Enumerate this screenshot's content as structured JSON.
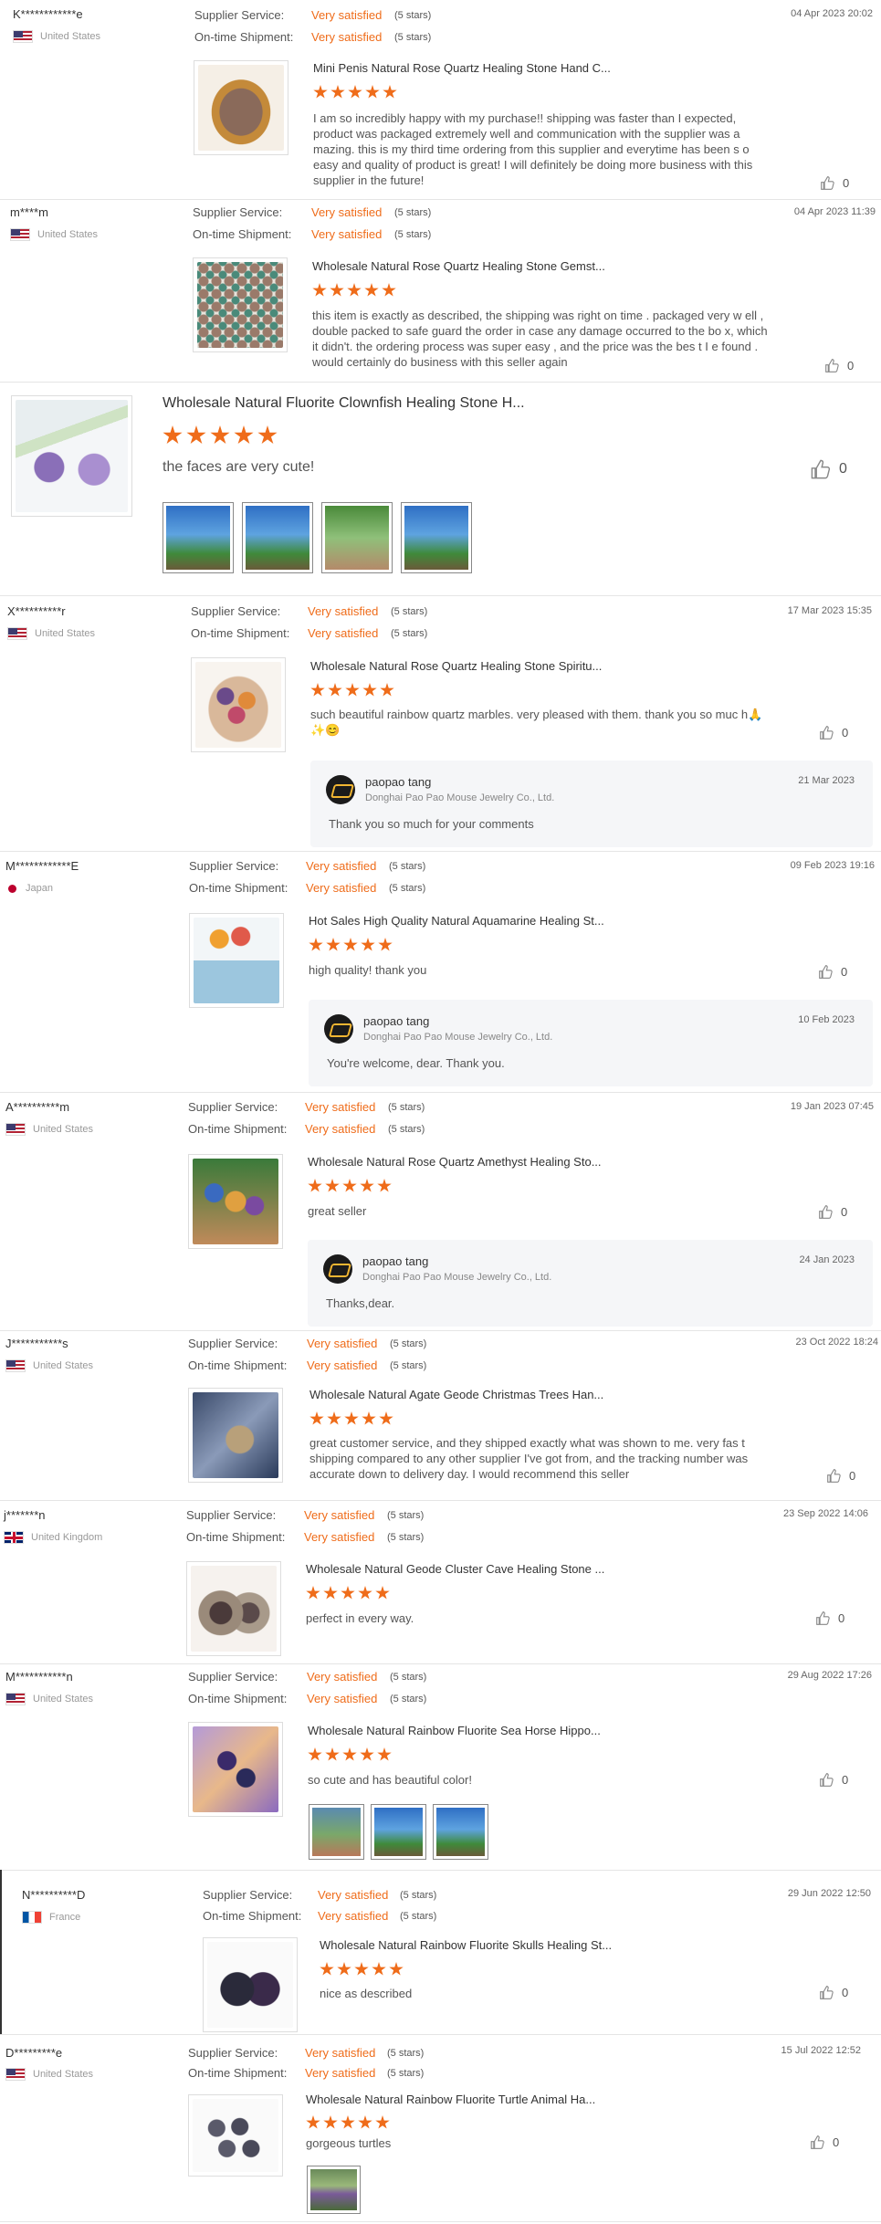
{
  "labels": {
    "supplier_service": "Supplier Service:",
    "ontime_shipment": "On-time Shipment:",
    "very_satisfied": "Very satisfied",
    "five_stars": "(5 stars)"
  },
  "colors": {
    "accent": "#ef6c1a",
    "reply_bg": "#f5f6f8"
  },
  "reviews": [
    {
      "buyer": "K************e",
      "country": "United States",
      "date": "04 Apr 2023 20:02",
      "product": "Mini Penis Natural Rose Quartz Healing Stone Hand C...",
      "text": "I am so incredibly happy with my purchase!! shipping was faster than I expected, product was packaged extremely well and communication with the supplier was a mazing. this is my third time ordering from this supplier and everytime has been s o easy and quality of product is great! I will definitely be doing more business with this supplier in the future!",
      "likes": "0"
    },
    {
      "buyer": "m****m",
      "country": "United States",
      "date": "04 Apr 2023 11:39",
      "product": "Wholesale Natural Rose Quartz Healing Stone Gemst...",
      "text": "this item is exactly as described, the shipping was right on time . packaged very w ell , double packed to safe guard the order in case any damage occurred to the bo x, which it didn't.  the ordering process was super easy , and the price was the bes t I e found . would certainly do business with this seller again",
      "likes": "0"
    },
    {
      "product": "Wholesale Natural Fluorite Clownfish Healing Stone H...",
      "text": "the faces are very cute!",
      "likes": "0"
    },
    {
      "buyer": "X**********r",
      "country": "United States",
      "date": "17 Mar 2023 15:35",
      "product": "Wholesale Natural Rose Quartz Healing Stone Spiritu...",
      "text": "such beautiful rainbow quartz marbles. very pleased with them. thank you so muc h",
      "emoji": "🙏✨😊",
      "likes": "0",
      "reply": {
        "name": "paopao tang",
        "company": "Donghai Pao Pao Mouse Jewelry Co., Ltd.",
        "date": "21 Mar 2023",
        "text": "Thank you so much for your comments"
      }
    },
    {
      "buyer": "M************E",
      "country": "Japan",
      "date": "09 Feb 2023 19:16",
      "product": "Hot Sales High Quality Natural Aquamarine Healing St...",
      "text": "high quality!  thank you",
      "likes": "0",
      "reply": {
        "name": "paopao tang",
        "company": "Donghai Pao Pao Mouse Jewelry Co., Ltd.",
        "date": "10 Feb 2023",
        "text": "You're welcome, dear. Thank you."
      }
    },
    {
      "buyer": "A**********m",
      "country": "United States",
      "date": "19 Jan 2023 07:45",
      "product": "Wholesale Natural Rose Quartz Amethyst Healing Sto...",
      "text": "great seller",
      "likes": "0",
      "reply": {
        "name": "paopao tang",
        "company": "Donghai Pao Pao Mouse Jewelry Co., Ltd.",
        "date": "24 Jan 2023",
        "text": "Thanks,dear."
      }
    },
    {
      "buyer": "J***********s",
      "country": "United States",
      "date": "23 Oct 2022 18:24",
      "product": "Wholesale Natural Agate Geode Christmas Trees Han...",
      "text": "great customer service, and they shipped exactly what was shown to me. very fas t shipping compared to any other supplier I've got from, and the tracking number was accurate down to delivery day. I would recommend this seller",
      "likes": "0"
    },
    {
      "buyer": "j*******n",
      "country": "United Kingdom",
      "date": "23 Sep 2022 14:06",
      "product": "Wholesale Natural Geode Cluster Cave Healing Stone ...",
      "text": "perfect in every way.",
      "likes": "0"
    },
    {
      "buyer": "M***********n",
      "country": "United States",
      "date": "29 Aug 2022 17:26",
      "product": "Wholesale Natural Rainbow Fluorite Sea Horse Hippo...",
      "text": "so cute and has beautiful color!",
      "likes": "0"
    },
    {
      "buyer": "N**********D",
      "country": "France",
      "date": "29 Jun 2022 12:50",
      "product": "Wholesale Natural Rainbow Fluorite Skulls Healing St...",
      "text": "nice as described",
      "likes": "0"
    },
    {
      "buyer": "D*********e",
      "country": "United States",
      "date": "15 Jul 2022 12:52",
      "product": "Wholesale Natural Rainbow Fluorite Turtle Animal Ha...",
      "text": "gorgeous turtles",
      "likes": "0"
    }
  ]
}
